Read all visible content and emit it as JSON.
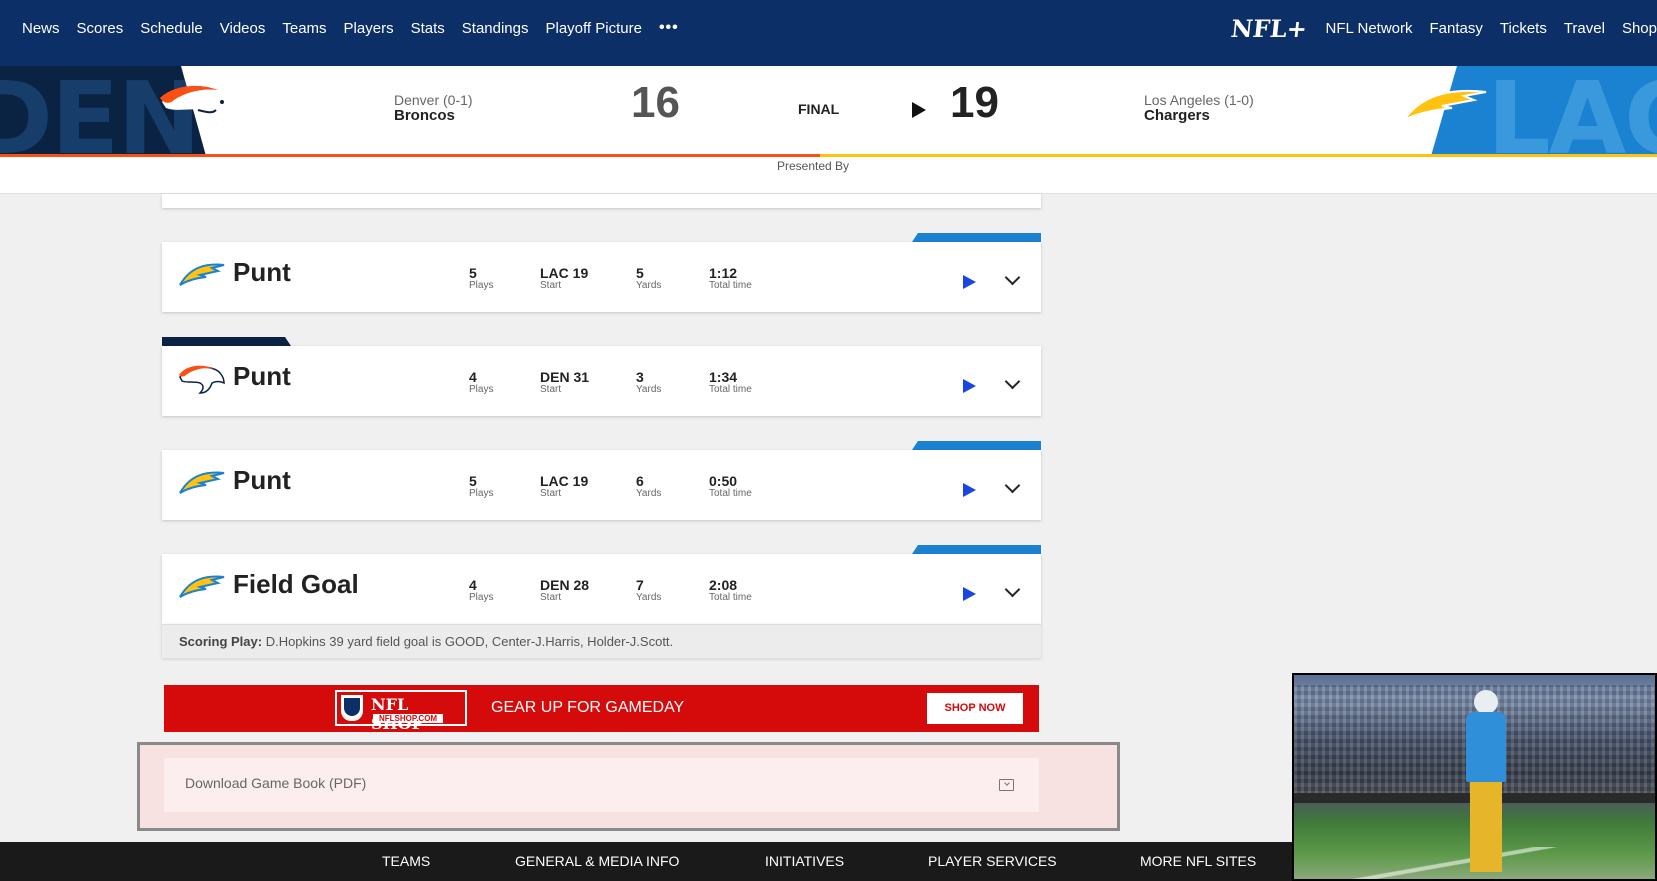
{
  "nav": {
    "left_items": [
      "News",
      "Scores",
      "Schedule",
      "Videos",
      "Teams",
      "Players",
      "Stats",
      "Standings",
      "Playoff Picture"
    ],
    "more": "•••",
    "brand": "NFL+",
    "right_items": [
      "NFL Network",
      "Fantasy",
      "Tickets",
      "Travel",
      "Shop"
    ]
  },
  "game": {
    "away": {
      "city_record": "Denver (0-1)",
      "name": "Broncos",
      "score": "16",
      "abbr": "DEN",
      "color": "#fb4f14"
    },
    "home": {
      "city_record": "Los Angeles (1-0)",
      "name": "Chargers",
      "score": "19",
      "abbr": "LAC",
      "color": "#1b82d1"
    },
    "status": "FINAL",
    "presented_by": "Presented By"
  },
  "drives": [
    {
      "team": "LAC",
      "result": "Punt",
      "plays": "5",
      "plays_label": "Plays",
      "start": "LAC 19",
      "start_label": "Start",
      "yards": "5",
      "yards_label": "Yards",
      "time": "1:12",
      "time_label": "Total time"
    },
    {
      "team": "DEN",
      "result": "Punt",
      "plays": "4",
      "plays_label": "Plays",
      "start": "DEN 31",
      "start_label": "Start",
      "yards": "3",
      "yards_label": "Yards",
      "time": "1:34",
      "time_label": "Total time"
    },
    {
      "team": "LAC",
      "result": "Punt",
      "plays": "5",
      "plays_label": "Plays",
      "start": "LAC 19",
      "start_label": "Start",
      "yards": "6",
      "yards_label": "Yards",
      "time": "0:50",
      "time_label": "Total time"
    },
    {
      "team": "LAC",
      "result": "Field Goal",
      "plays": "4",
      "plays_label": "Plays",
      "start": "DEN 28",
      "start_label": "Start",
      "yards": "7",
      "yards_label": "Yards",
      "time": "2:08",
      "time_label": "Total time"
    }
  ],
  "scoring_play": {
    "label": "Scoring Play:",
    "text": " D.Hopkins 39 yard field goal is GOOD, Center-J.Harris, Holder-J.Scott."
  },
  "ad": {
    "logo_title": "NFL SHOP",
    "logo_url": "NFLSHOP.COM",
    "tagline": "GEAR UP FOR GAMEDAY",
    "button": "SHOP NOW"
  },
  "download": {
    "label": "Download Game Book (PDF)"
  },
  "footer": {
    "items": [
      "TEAMS",
      "GENERAL & MEDIA INFO",
      "INITIATIVES",
      "PLAYER SERVICES",
      "MORE NFL SITES"
    ]
  }
}
